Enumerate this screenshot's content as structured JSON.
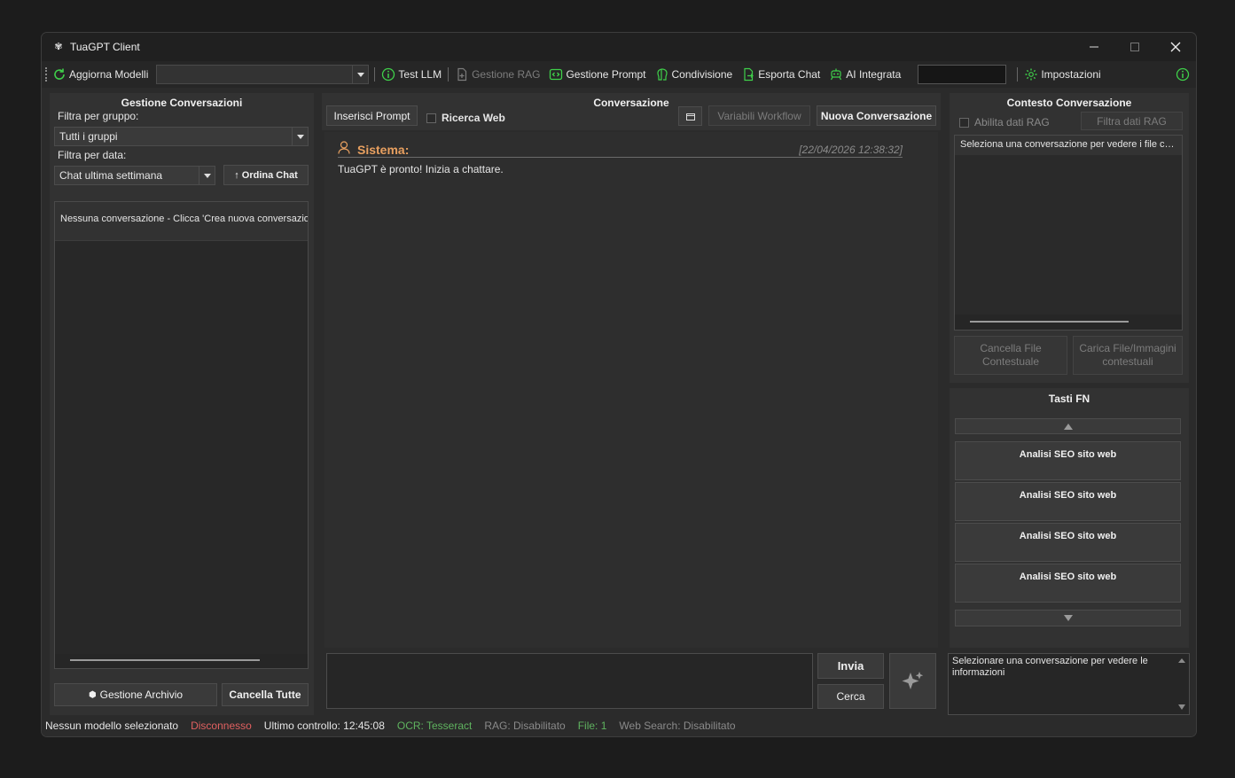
{
  "window": {
    "title": "TuaGPT Client"
  },
  "toolbar": {
    "refresh_models": "Aggiorna Modelli",
    "model_select_value": "",
    "test_llm": "Test LLM",
    "rag_management": "Gestione RAG",
    "prompt_management": "Gestione Prompt",
    "sharing": "Condivisione",
    "export_chat": "Esporta Chat",
    "integrated_ai": "AI Integrata",
    "settings": "Impostazioni"
  },
  "left": {
    "title": "Gestione Conversazioni",
    "group_filter_label": "Filtra per gruppo:",
    "group_filter_value": "Tutti i gruppi",
    "date_filter_label": "Filtra per data:",
    "date_filter_value": "Chat ultima settimana",
    "sort_button": "↑ Ordina Chat",
    "empty_message": "Nessuna conversazione - Clicca 'Crea nuova conversazione'",
    "archive_button": "Gestione Archivio",
    "delete_all_button": "Cancella Tutte"
  },
  "center": {
    "title": "Conversazione",
    "insert_prompt": "Inserisci Prompt",
    "web_search_label": "Ricerca Web",
    "workflow_vars": "Variabili Workflow",
    "new_conversation": "Nuova Conversazione",
    "messages": [
      {
        "sender": "Sistema:",
        "timestamp": "[22/04/2026 12:38:32]",
        "text": "TuaGPT è pronto! Inizia a chattare."
      }
    ],
    "input_value": "",
    "send_button": "Invia",
    "search_button": "Cerca"
  },
  "right": {
    "title": "Contesto Conversazione",
    "enable_rag_label": "Abilita dati RAG",
    "filter_rag_button": "Filtra dati RAG",
    "context_text": "Seleziona una conversazione per vedere i file contestuali",
    "delete_context_file": "Cancella File Contestuale",
    "upload_context_files": "Carica File/Immagini contestuali",
    "fn_title": "Tasti FN",
    "fn_buttons": [
      "Analisi SEO sito web",
      "Analisi SEO sito web",
      "Analisi SEO sito web",
      "Analisi SEO sito web"
    ],
    "info_text": "Selezionare una conversazione per vedere le informazioni"
  },
  "status": {
    "model": "Nessun modello selezionato",
    "connection": "Disconnesso",
    "last_check": "Ultimo controllo: 12:45:08",
    "ocr": "OCR: Tesseract",
    "rag": "RAG: Disabilitato",
    "files": "File: 1",
    "web_search": "Web Search: Disabilitato"
  },
  "colors": {
    "accent_green": "#3fd04a",
    "sender_orange": "#e8a060",
    "status_red": "#e06060",
    "status_green": "#5fb35f"
  }
}
